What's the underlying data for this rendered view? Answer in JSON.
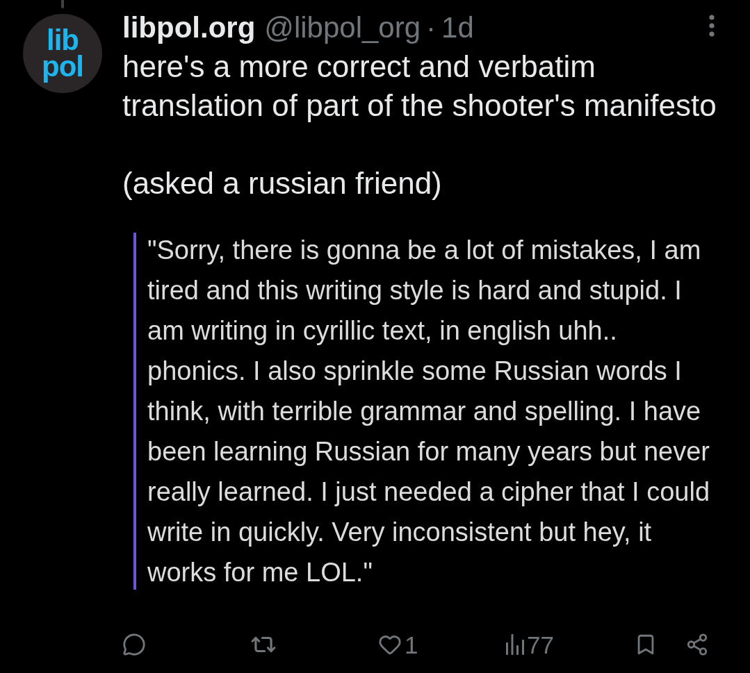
{
  "post": {
    "author": {
      "avatar_logo": [
        "lib",
        "pol"
      ],
      "name": "libpol.org",
      "handle": "@libpol_org",
      "separator": "·",
      "time": "1d"
    },
    "paragraphs": [
      [
        "here's a more correct and verbatim",
        "translation of part of the shooter's manifesto"
      ],
      [
        "(asked a russian friend)"
      ]
    ],
    "quote": [
      "\"Sorry, there is gonna be a lot of mistakes, I am",
      "tired and this writing style is hard and stupid. I",
      "am writing in cyrillic text, in english uhh..",
      "phonics. I also sprinkle some Russian words I",
      "think, with terrible grammar and spelling. I have",
      "been learning Russian for many years but never",
      "really learned. I just needed a cipher that I could",
      "write in quickly. Very inconsistent but hey, it",
      "works for me LOL.\""
    ]
  },
  "actions": [
    {
      "kind": "reply"
    },
    {
      "kind": "repost"
    },
    {
      "kind": "like",
      "count": "1"
    },
    {
      "kind": "views",
      "count": "77"
    },
    {
      "kind": "bookmark"
    },
    {
      "kind": "share"
    }
  ]
}
